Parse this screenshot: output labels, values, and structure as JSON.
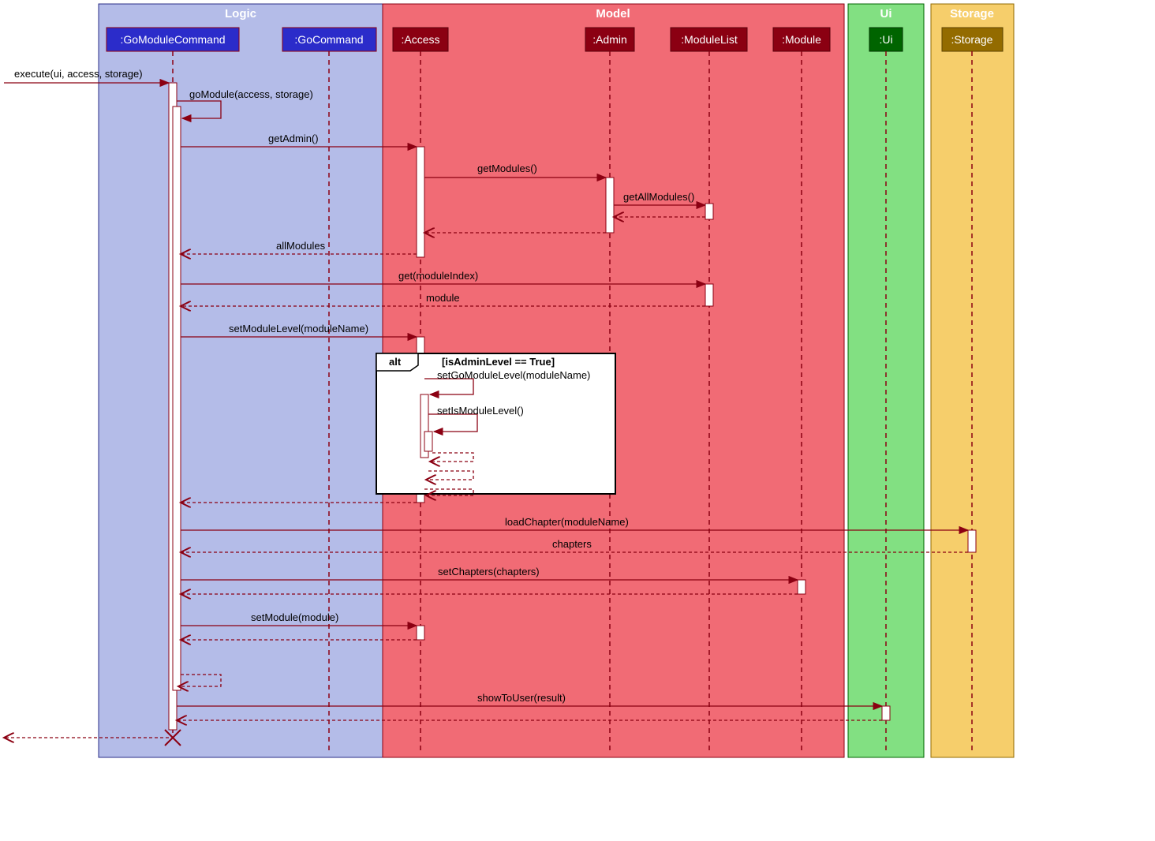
{
  "packages": {
    "logic": {
      "label": "Logic"
    },
    "model": {
      "label": "Model"
    },
    "ui": {
      "label": "Ui"
    },
    "storage": {
      "label": "Storage"
    }
  },
  "participants": {
    "goModule": ":GoModuleCommand",
    "goCmd": ":GoCommand",
    "access": ":Access",
    "admin": ":Admin",
    "modList": ":ModuleList",
    "module": ":Module",
    "ui": ":Ui",
    "storage": ":Storage"
  },
  "messages": {
    "execute": "execute(ui, access, storage)",
    "goModule": "goModule(access, storage)",
    "getAdmin": "getAdmin()",
    "getModules": "getModules()",
    "getAllModules": "getAllModules()",
    "allModules": "allModules",
    "getIndex": "get(moduleIndex)",
    "moduleRet": "module",
    "setModuleLevel": "setModuleLevel(moduleName)",
    "altCond": "[isAdminLevel == True]",
    "altTag": "alt",
    "setGoModuleLevel": "setGoModuleLevel(moduleName)",
    "setIsModuleLevel": "setIsModuleLevel()",
    "loadChapter": "loadChapter(moduleName)",
    "chapters": "chapters",
    "setChapters": "setChapters(chapters)",
    "setModule": "setModule(module)",
    "showToUser": "showToUser(result)"
  }
}
